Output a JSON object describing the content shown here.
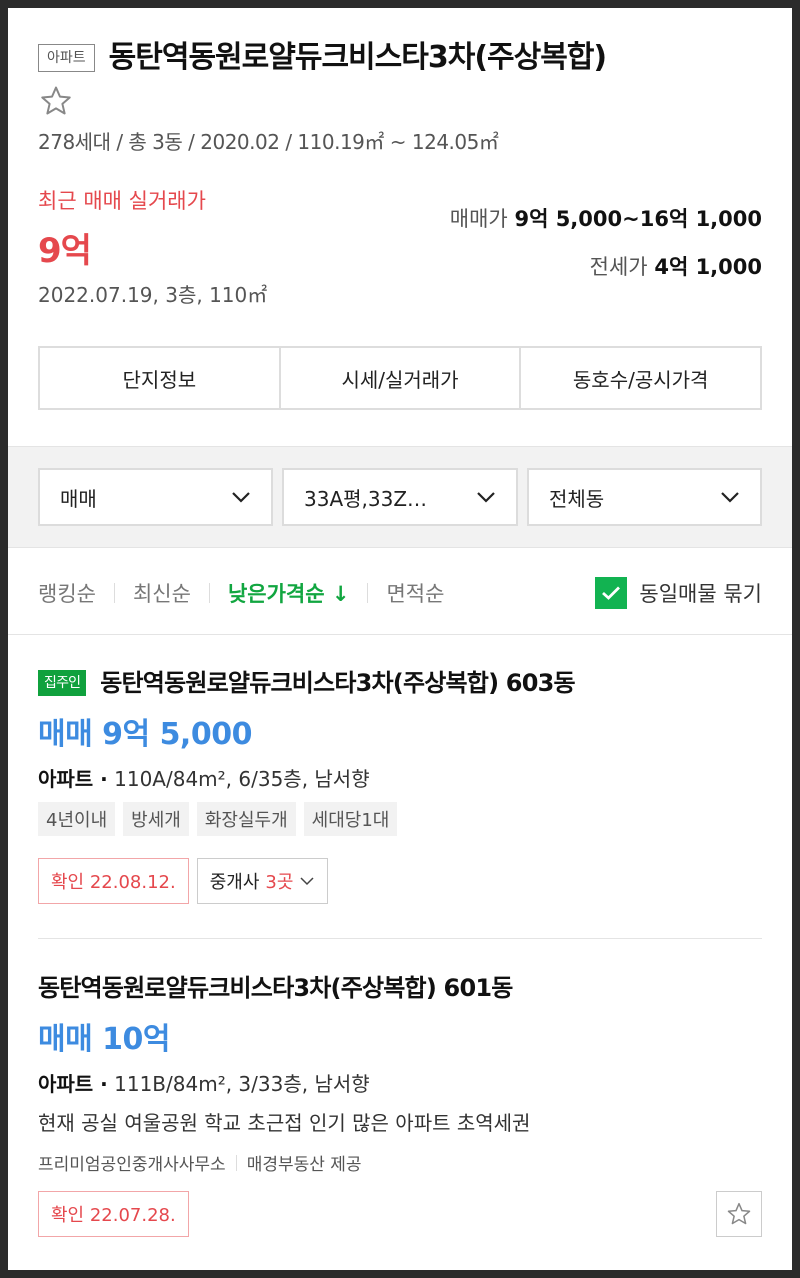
{
  "header": {
    "type_tag": "아파트",
    "title": "동탄역동원로얄듀크비스타3차(주상복합)",
    "summary": "278세대 / 총 3동 / 2020.02 / 110.19㎡ ~ 124.05㎡"
  },
  "recent": {
    "label": "최근 매매 실거래가",
    "price": "9억",
    "detail": "2022.07.19, 3층, 110㎡"
  },
  "price_range": {
    "sale_label": "매매가",
    "sale_value": "9억 5,000~16억 1,000",
    "jeonse_label": "전세가",
    "jeonse_value": "4억 1,000"
  },
  "tabs": [
    "단지정보",
    "시세/실거래가",
    "동호수/공시가격"
  ],
  "filters": {
    "trade_type": "매매",
    "area": "33A평,33Z…",
    "building": "전체동"
  },
  "sort": {
    "items": [
      "랭킹순",
      "최신순",
      "낮은가격순 ↓",
      "면적순"
    ],
    "group_label": "동일매물 묶기"
  },
  "listings": [
    {
      "badge": "집주인",
      "title": "동탄역동원로얄듀크비스타3차(주상복합) 603동",
      "price": "매매 9억 5,000",
      "spec_type": "아파트 ·",
      "spec_detail": " 110A/84m², 6/35층, 남서향",
      "tags": [
        "4년이내",
        "방세개",
        "화장실두개",
        "세대당1대"
      ],
      "confirm": "확인 22.08.12.",
      "agency_label": "중개사",
      "agency_count": "3곳"
    },
    {
      "title": "동탄역동원로얄듀크비스타3차(주상복합) 601동",
      "price": "매매 10억",
      "spec_type": "아파트 ·",
      "spec_detail": " 111B/84m², 3/33층, 남서향",
      "desc": "현재 공실 여울공원 학교 초근접 인기 많은 아파트 초역세권",
      "agency": "프리미엄공인중개사사무소",
      "provider": "매경부동산 제공",
      "confirm": "확인 22.07.28."
    }
  ],
  "colors": {
    "red": "#e5484d",
    "green": "#11a640",
    "blue": "#3d8be0"
  }
}
